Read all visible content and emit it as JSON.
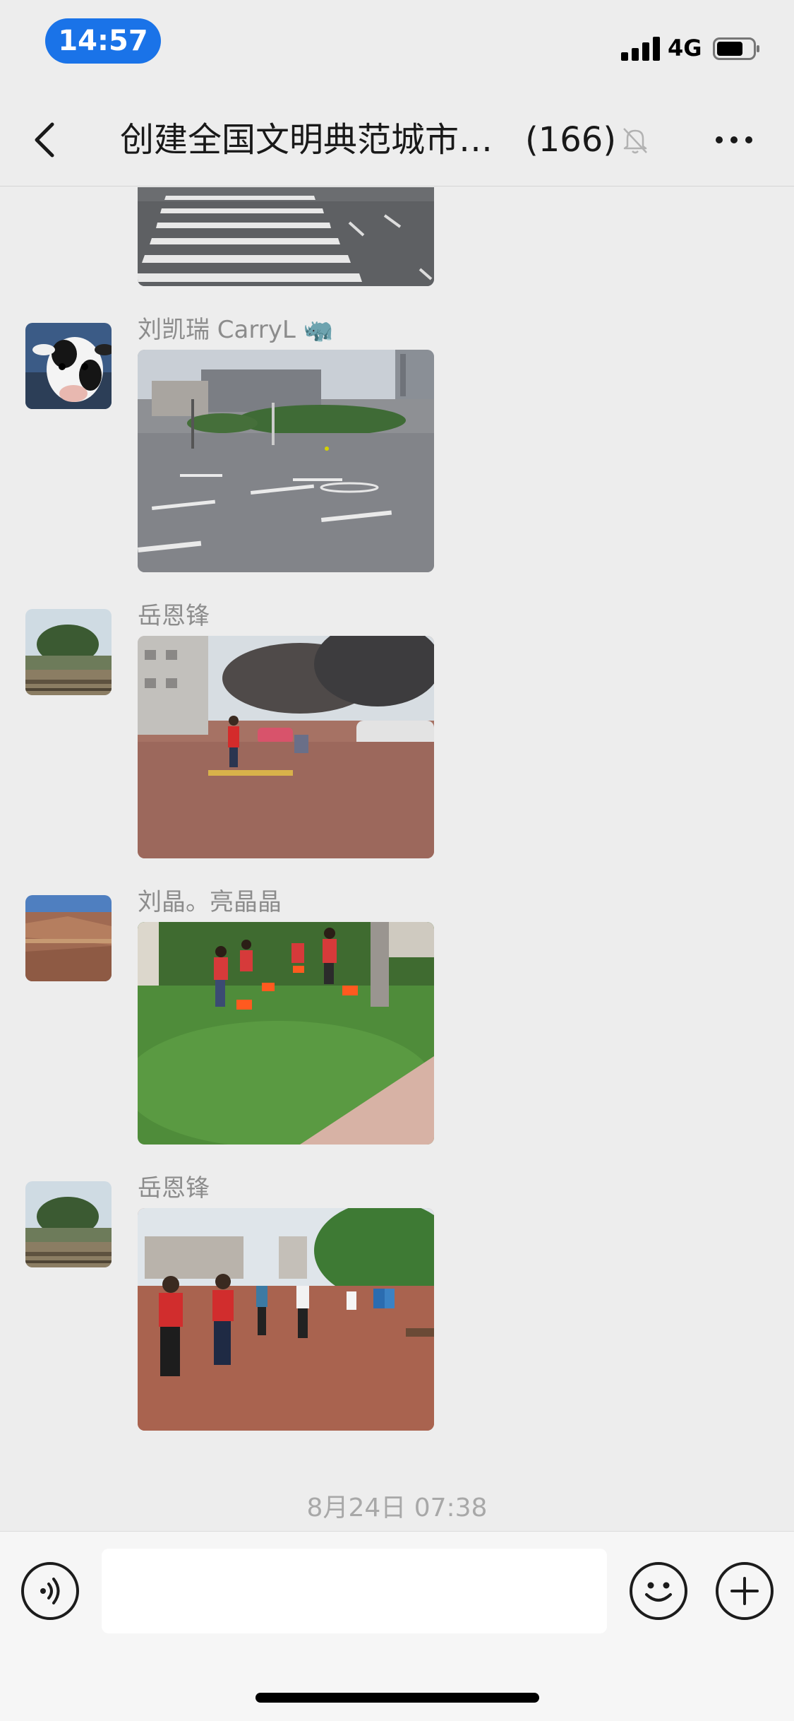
{
  "status_bar": {
    "time": "14:57",
    "network": "4G",
    "icons": [
      "signal-icon",
      "battery-icon"
    ]
  },
  "nav": {
    "back_icon": "chevron-left-icon",
    "title": "创建全国文明典范城市…",
    "member_count": "(166)",
    "mute_icon": "bell-slash-icon",
    "more_icon": "ellipsis-icon"
  },
  "messages": [
    {
      "sender": "",
      "type": "image",
      "image": "crosswalk-road-photo"
    },
    {
      "sender": "刘凯瑞 CarryL",
      "sender_emoji": "🦏",
      "avatar": "cow-avatar",
      "type": "image",
      "image": "intersection-photo"
    },
    {
      "sender": "岳恩锋",
      "avatar": "landscape-avatar",
      "type": "image",
      "image": "sidewalk-volunteer-photo"
    },
    {
      "sender": "刘晶。亮晶晶",
      "avatar": "canyon-avatar",
      "type": "image",
      "image": "volunteers-cleaning-grass-photo"
    },
    {
      "sender": "岳恩锋",
      "avatar": "landscape-avatar",
      "type": "image",
      "image": "volunteers-plaza-photo"
    }
  ],
  "timestamp": "8月24日 07:38",
  "input_bar": {
    "voice_icon": "voice-icon",
    "emoji_icon": "smiley-icon",
    "plus_icon": "plus-icon",
    "input_value": ""
  },
  "colors": {
    "background": "#ededed",
    "time_pill": "#1a73e8",
    "sender_text": "#8c8c8c"
  }
}
